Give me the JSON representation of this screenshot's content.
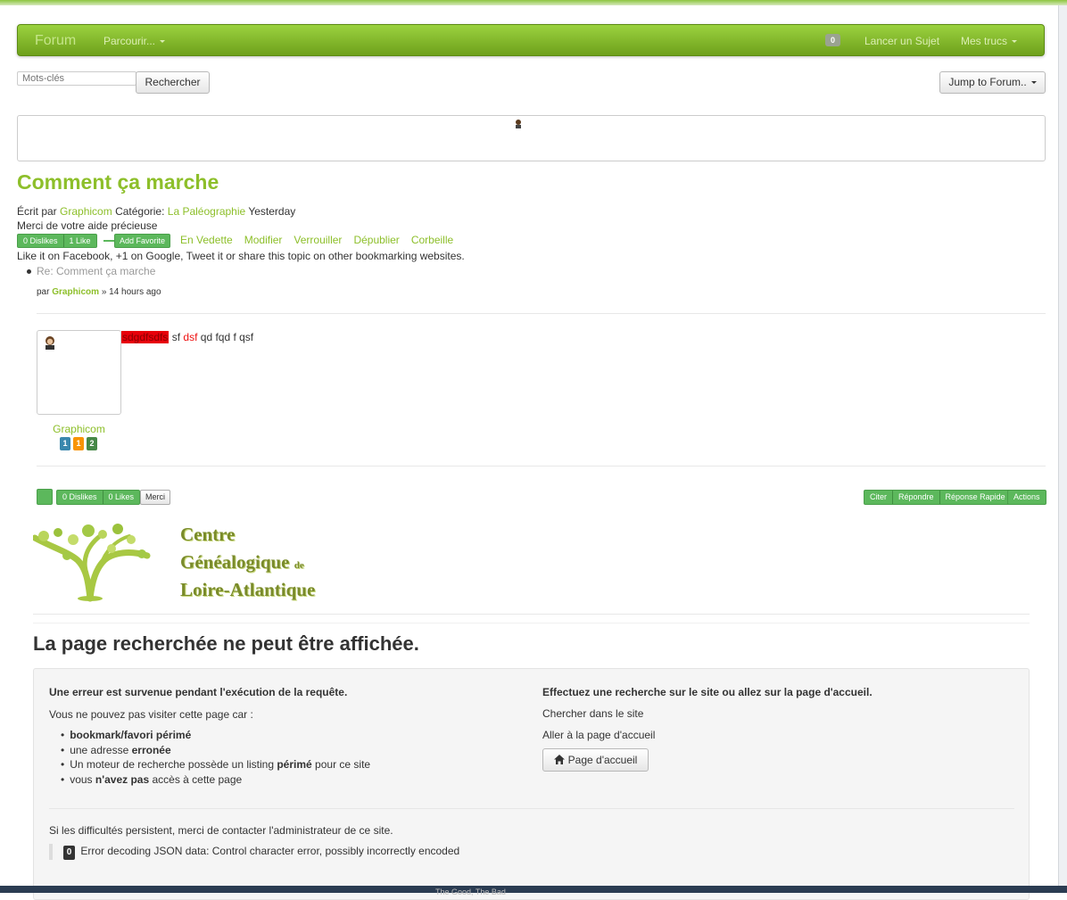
{
  "navbar": {
    "brand": "Forum",
    "browse_label": "Parcourir...",
    "notif_count": "0",
    "new_topic_label": "Lancer un Sujet",
    "my_stuff_label": "Mes trucs"
  },
  "search": {
    "placeholder": "Mots-clés",
    "button_label": "Rechercher"
  },
  "jump_to_forum_label": "Jump to Forum..",
  "topic": {
    "title": "Comment ça marche",
    "written_by_label": "Écrit par",
    "author": "Graphicom",
    "category_label": "Catégorie:",
    "category": "La Paléographie",
    "date": "Yesterday",
    "description": "Merci de votre aide précieuse",
    "dislikes": "0 Dislikes",
    "likes": "1 Like",
    "favorite_label": "Add Favorite",
    "mod_actions": [
      "En Vedette",
      "Modifier",
      "Verrouiller",
      "Dépublier",
      "Corbeille"
    ],
    "share_text": "Like it on Facebook, +1 on Google, Tweet it or share this topic on other bookmarking websites."
  },
  "reply": {
    "title": "Re: Comment ça marche",
    "by_prefix": "par",
    "author": "Graphicom",
    "time_suffix": "» 14 hours ago",
    "body_highlight": "sdgdfsdfs",
    "body_part1": "sf",
    "body_red": "dsf",
    "body_part2": "qd fqd f qsf",
    "author_name": "Graphicom",
    "rank_badges": [
      "1",
      "1",
      "2"
    ],
    "dislikes": "0 Dislikes",
    "likes": "0 Likes",
    "thanks_label": "Merci",
    "actions": [
      "Citer",
      "Répondre",
      "Réponse Rapide"
    ],
    "actions_menu": "Actions"
  },
  "logo": {
    "line1": "Centre",
    "line2": "Généalogique",
    "line2_small": "de",
    "line3": "Loire-Atlantique"
  },
  "error": {
    "title": "La page recherchée ne peut être affichée.",
    "left_heading": "Une erreur est survenue pendant l'exécution de la requête.",
    "reason_intro": "Vous ne pouvez pas visiter cette page car :",
    "reasons": [
      {
        "bold": "bookmark/favori périmé",
        "pre": "",
        "post": ""
      },
      {
        "pre": "une adresse",
        "bold": "erronée",
        "post": ""
      },
      {
        "pre": "Un moteur de recherche possède un listing",
        "bold": "périmé",
        "post": "pour ce site"
      },
      {
        "pre": "vous",
        "bold": "n'avez pas",
        "post": "accès à cette page"
      }
    ],
    "right_heading": "Effectuez une recherche sur le site ou allez sur la page d'accueil.",
    "search_site": "Chercher dans le site",
    "goto_home": "Aller à la page d'accueil",
    "home_button": "Page d'accueil",
    "contact_text": "Si les difficultés persistent, merci de contacter l'administrateur de ce site.",
    "error_code": "0",
    "error_message": "Error decoding JSON data: Control character error, possibly incorrectly encoded"
  },
  "taskbar_text": "The Good, The Bad",
  "colors": {
    "brand_green": "#8dbf2a",
    "button_green": "#5cb85c",
    "badge_blue": "#3a87ad",
    "badge_orange": "#f89406",
    "badge_darkgreen": "#468847"
  }
}
